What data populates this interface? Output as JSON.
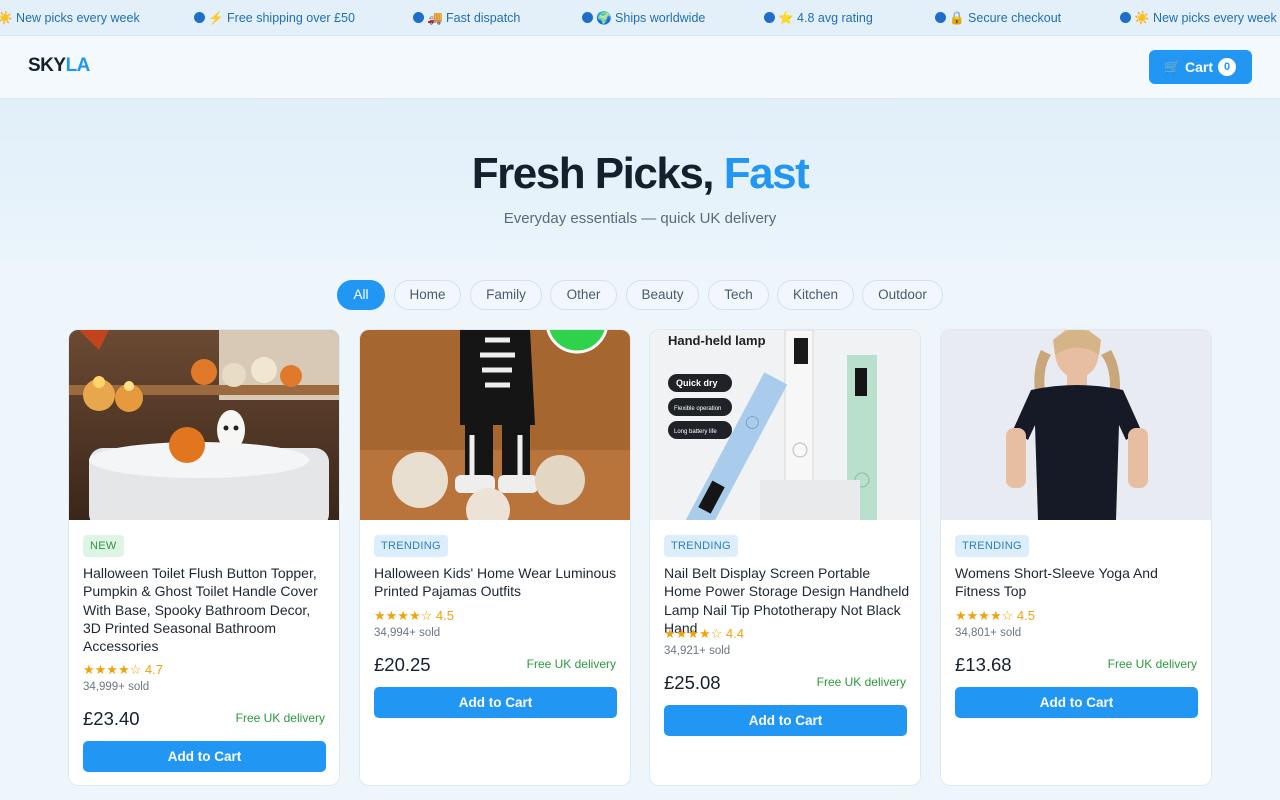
{
  "ticker": [
    "☀️ New picks every week",
    "⚡ Free shipping over £50",
    "🚚 Fast dispatch",
    "🌍 Ships worldwide",
    "⭐ 4.8 avg rating",
    "🔒 Secure checkout",
    "☀️ New picks every week"
  ],
  "header": {
    "logo_main": "SKY",
    "logo_accent": "LA",
    "cart_icon": "🛒",
    "cart_label": "Cart",
    "cart_count": "0"
  },
  "hero": {
    "title_main": "Fresh Picks, ",
    "title_accent": "Fast",
    "subtitle": "Everyday essentials — quick UK delivery"
  },
  "categories": [
    "All",
    "Home",
    "Family",
    "Other",
    "Beauty",
    "Tech",
    "Kitchen",
    "Outdoor"
  ],
  "products": [
    {
      "badge": "NEW",
      "title": "Halloween Toilet Flush Button Topper, Pumpkin & Ghost Toilet Handle Cover With Base, Spooky Bathroom Decor, 3D Printed Seasonal Bathroom Accessories",
      "stars": "★★★★☆",
      "rating": "4.7",
      "sold": "34,999+ sold",
      "price": "£23.40",
      "shipping": "Free UK delivery",
      "button": "Add to Cart"
    },
    {
      "badge": "TRENDING",
      "title": "Halloween Kids' Home Wear Luminous Printed Pajamas Outfits",
      "stars": "★★★★☆",
      "rating": "4.5",
      "sold": "34,994+ sold",
      "price": "£20.25",
      "shipping": "Free UK delivery",
      "button": "Add to Cart"
    },
    {
      "badge": "TRENDING",
      "title": "Nail Belt Display Screen Portable Home Power Storage Design Handheld Lamp Nail Tip Phototherapy Not Black Hand",
      "stars": "★★★★☆",
      "rating": "4.4",
      "sold": "34,921+ sold",
      "price": "£25.08",
      "shipping": "Free UK delivery",
      "button": "Add to Cart",
      "image_text": {
        "heading": "Hand-held lamp",
        "tag1": "Quick dry",
        "tag2": "Flexible operation",
        "tag3": "Long battery life"
      }
    },
    {
      "badge": "TRENDING",
      "title": "Womens Short-Sleeve Yoga And Fitness Top",
      "stars": "★★★★☆",
      "rating": "4.5",
      "sold": "34,801+ sold",
      "price": "£13.68",
      "shipping": "Free UK delivery",
      "button": "Add to Cart"
    }
  ]
}
